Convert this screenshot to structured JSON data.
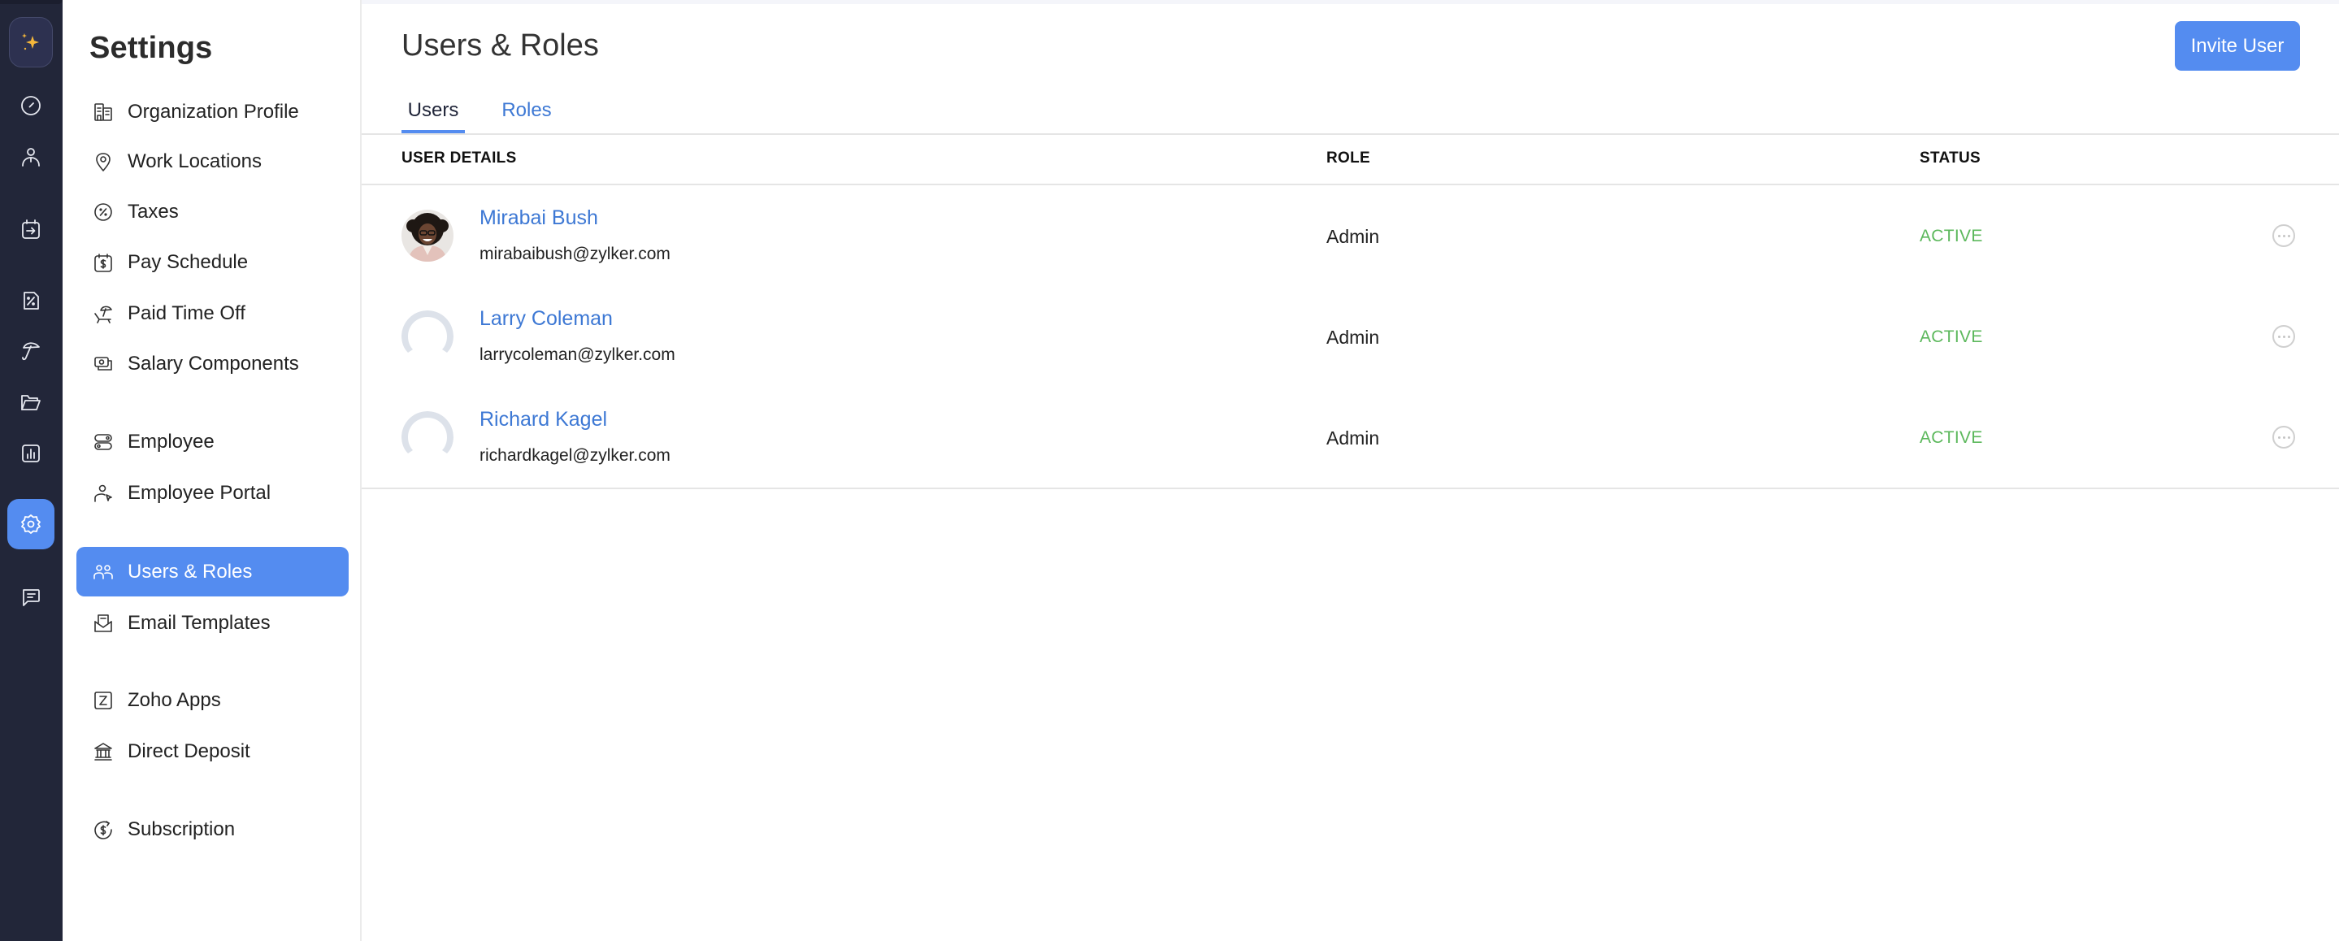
{
  "rail": {
    "items": [
      {
        "name": "ai-assistant",
        "icon": "sparkle-icon"
      },
      {
        "name": "dashboard",
        "icon": "gauge-icon"
      },
      {
        "name": "employees",
        "icon": "person-icon"
      },
      {
        "name": "pay-runs",
        "icon": "calendar-arrow-icon"
      },
      {
        "name": "taxes",
        "icon": "percent-document-icon"
      },
      {
        "name": "benefits",
        "icon": "umbrella-icon"
      },
      {
        "name": "documents",
        "icon": "folder-icon"
      },
      {
        "name": "reports",
        "icon": "bar-chart-icon"
      },
      {
        "name": "settings",
        "icon": "gear-icon",
        "active": true
      },
      {
        "name": "feedback",
        "icon": "chat-icon"
      }
    ]
  },
  "sidebar": {
    "title": "Settings",
    "items": [
      {
        "label": "Organization Profile",
        "icon": "building-icon"
      },
      {
        "label": "Work Locations",
        "icon": "map-pin-icon"
      },
      {
        "label": "Taxes",
        "icon": "percent-circle-icon"
      },
      {
        "label": "Pay Schedule",
        "icon": "calendar-dollar-icon"
      },
      {
        "label": "Paid Time Off",
        "icon": "beach-chair-icon"
      },
      {
        "label": "Salary Components",
        "icon": "money-icon"
      },
      {
        "label": "Employee",
        "icon": "toggles-icon"
      },
      {
        "label": "Employee Portal",
        "icon": "user-pointer-icon"
      },
      {
        "label": "Users & Roles",
        "icon": "users-icon",
        "active": true
      },
      {
        "label": "Email Templates",
        "icon": "mail-open-icon"
      },
      {
        "label": "Zoho Apps",
        "icon": "zoho-z-icon"
      },
      {
        "label": "Direct Deposit",
        "icon": "bank-icon"
      },
      {
        "label": "Subscription",
        "icon": "dollar-refresh-icon"
      }
    ]
  },
  "main": {
    "title": "Users & Roles",
    "invite_label": "Invite User",
    "tabs": [
      {
        "label": "Users",
        "active": true
      },
      {
        "label": "Roles",
        "active": false
      }
    ],
    "table": {
      "headers": [
        "USER DETAILS",
        "ROLE",
        "STATUS"
      ],
      "rows": [
        {
          "name": "Mirabai Bush",
          "email": "mirabaibush@zylker.com",
          "role": "Admin",
          "status": "ACTIVE",
          "avatar": "photo"
        },
        {
          "name": "Larry Coleman",
          "email": "larrycoleman@zylker.com",
          "role": "Admin",
          "status": "ACTIVE",
          "avatar": "placeholder"
        },
        {
          "name": "Richard Kagel",
          "email": "richardkagel@zylker.com",
          "role": "Admin",
          "status": "ACTIVE",
          "avatar": "placeholder"
        }
      ]
    }
  },
  "colors": {
    "accent": "#548cf0",
    "link": "#3d78d4",
    "status_active": "#5cb85c",
    "rail_bg": "#222639",
    "sparkle": "#f5b73b"
  }
}
